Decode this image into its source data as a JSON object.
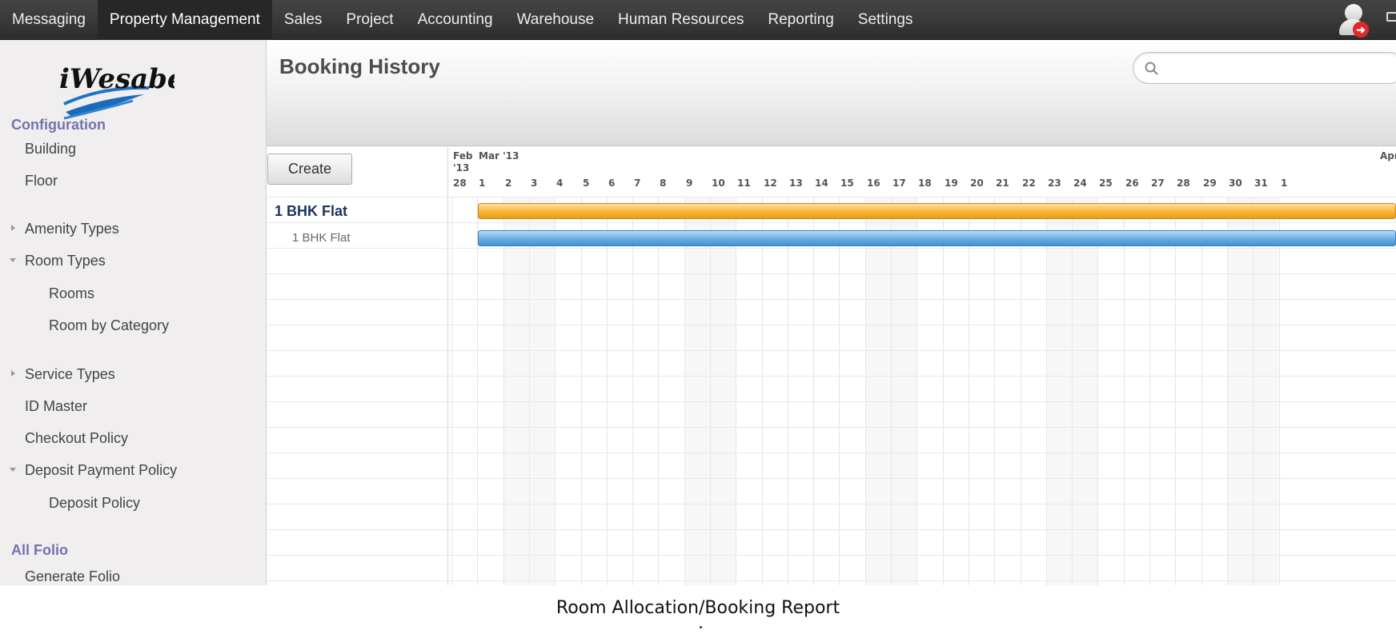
{
  "topnav": {
    "items": [
      {
        "label": "Messaging",
        "active": false
      },
      {
        "label": "Property Management",
        "active": true
      },
      {
        "label": "Sales",
        "active": false
      },
      {
        "label": "Project",
        "active": false
      },
      {
        "label": "Accounting",
        "active": false
      },
      {
        "label": "Warehouse",
        "active": false
      },
      {
        "label": "Human Resources",
        "active": false
      },
      {
        "label": "Reporting",
        "active": false
      },
      {
        "label": "Settings",
        "active": false
      }
    ],
    "user_icon": "user-avatar-icon",
    "logout_icon": "logout-icon",
    "mail_icon": "mail-icon"
  },
  "sidebar": {
    "logo_text": "iWesabe",
    "configuration_title": "Configuration",
    "items": {
      "building": "Building",
      "floor": "Floor",
      "amenity_types": "Amenity Types",
      "room_types": "Room Types",
      "rooms": "Rooms",
      "room_by_category": "Room by Category",
      "service_types": "Service Types",
      "id_master": "ID Master",
      "checkout_policy": "Checkout Policy",
      "deposit_payment_policy": "Deposit Payment Policy",
      "deposit_policy": "Deposit Policy"
    },
    "all_folio_title": "All Folio",
    "generate_folio": "Generate Folio"
  },
  "header": {
    "title": "Booking History",
    "search_placeholder": ""
  },
  "gantt": {
    "create_label": "Create",
    "group_label": "1 BHK Flat",
    "sub_label": "1 BHK Flat",
    "months": {
      "feb": "Feb '13",
      "mar": "Mar '13",
      "apr": "Apr"
    },
    "days": [
      "28",
      "1",
      "2",
      "3",
      "4",
      "5",
      "6",
      "7",
      "8",
      "9",
      "10",
      "11",
      "12",
      "13",
      "14",
      "15",
      "16",
      "17",
      "18",
      "19",
      "20",
      "21",
      "22",
      "23",
      "24",
      "25",
      "26",
      "27",
      "28",
      "29",
      "30",
      "31",
      "1"
    ],
    "bars": [
      {
        "row": "1 BHK Flat (group)",
        "start": "Mar 1",
        "end": "Apr 1+",
        "color": "#f2a92a"
      },
      {
        "row": "1 BHK Flat",
        "start": "Mar 1",
        "end": "Apr 1+",
        "color": "#5aa0dc"
      }
    ]
  },
  "caption": "Room Allocation/Booking Report"
}
